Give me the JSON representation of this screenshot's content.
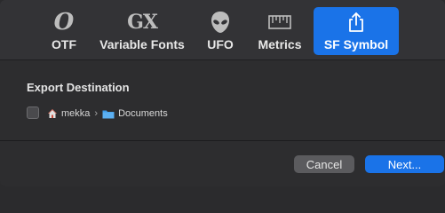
{
  "toolbar": {
    "tabs": [
      {
        "id": "otf",
        "label": "OTF",
        "icon": "otf-glyph-icon"
      },
      {
        "id": "variable",
        "label": "Variable Fonts",
        "icon": "gx-icon"
      },
      {
        "id": "ufo",
        "label": "UFO",
        "icon": "alien-icon"
      },
      {
        "id": "metrics",
        "label": "Metrics",
        "icon": "ruler-icon"
      },
      {
        "id": "sfsymbol",
        "label": "SF Symbol",
        "icon": "share-icon",
        "selected": true
      }
    ],
    "otf_glyph": "O",
    "gx_glyph": "GX"
  },
  "export": {
    "title": "Export Destination",
    "checked": false,
    "path": {
      "home": "mekka",
      "separator": "›",
      "folder": "Documents"
    }
  },
  "buttons": {
    "cancel": "Cancel",
    "next": "Next..."
  },
  "colors": {
    "accent": "#1a73e8",
    "background": "#2d2d2f",
    "toolbar": "#333336"
  }
}
